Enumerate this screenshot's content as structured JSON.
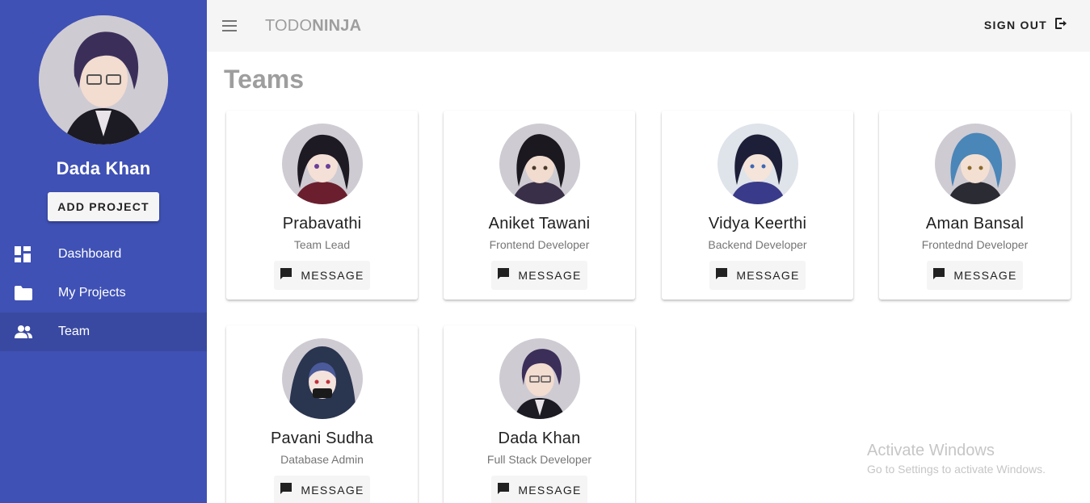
{
  "app": {
    "brand_part1": "TODO",
    "brand_part2": "NINJA",
    "sign_out": "SIGN OUT"
  },
  "sidebar": {
    "profile_name": "Dada Khan",
    "add_project": "ADD PROJECT",
    "items": [
      {
        "label": "Dashboard",
        "icon": "dashboard-icon"
      },
      {
        "label": "My Projects",
        "icon": "folder-icon"
      },
      {
        "label": "Team",
        "icon": "people-icon",
        "active": true
      }
    ]
  },
  "page": {
    "title": "Teams"
  },
  "team": [
    {
      "name": "Prabavathi",
      "role": "Team Lead",
      "action": "MESSAGE",
      "hair": "#1e1a24"
    },
    {
      "name": "Aniket Tawani",
      "role": "Frontend Developer",
      "action": "MESSAGE",
      "hair": "#1b1820"
    },
    {
      "name": "Vidya Keerthi",
      "role": "Backend Developer",
      "action": "MESSAGE",
      "hair": "#1d1f38"
    },
    {
      "name": "Aman Bansal",
      "role": "Frontednd Developer",
      "action": "MESSAGE",
      "hair": "#4a86b8"
    },
    {
      "name": "Pavani Sudha",
      "role": "Database Admin",
      "action": "MESSAGE",
      "hair": "#2a3550"
    },
    {
      "name": "Dada Khan",
      "role": "Full Stack Developer",
      "action": "MESSAGE",
      "hair": "#3b2f5a"
    }
  ],
  "watermark": {
    "line1": "Activate Windows",
    "line2": "Go to Settings to activate Windows."
  },
  "colors": {
    "sidebar": "#3f51b5",
    "sidebar_active": "#3949a1",
    "toolbar": "#f5f5f5",
    "title": "#9e9e9e"
  }
}
